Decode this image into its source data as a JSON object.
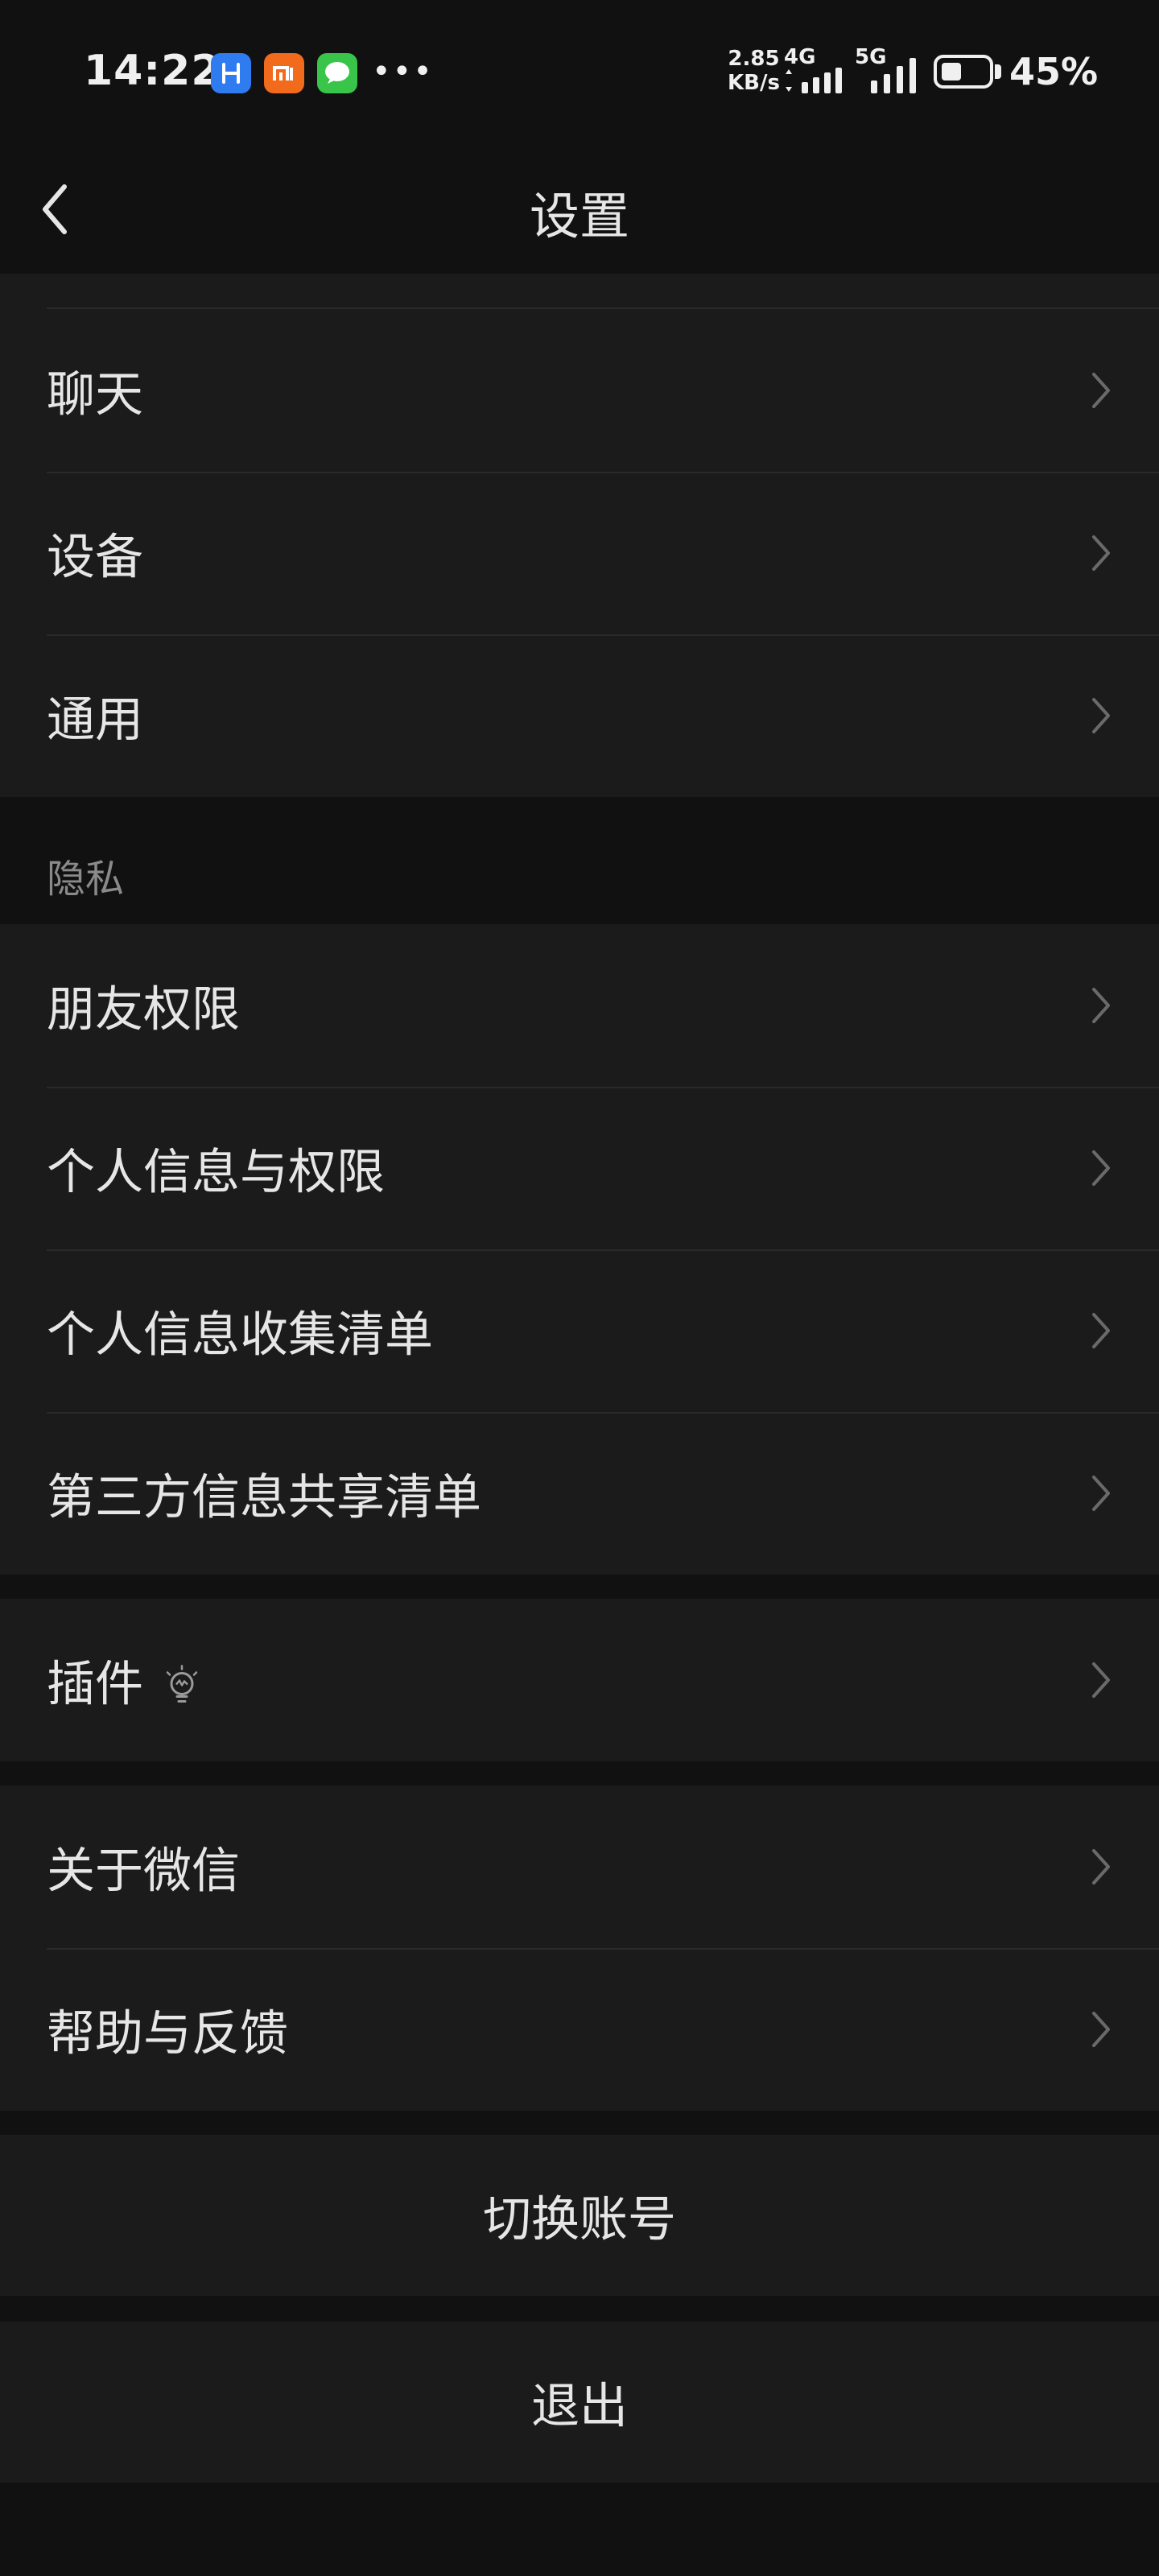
{
  "status_bar": {
    "time": "14:22",
    "net_speed_value": "2.85",
    "net_speed_unit": "KB/s",
    "signal1_label": "4G",
    "signal2_label": "5G",
    "battery_percent": "45%",
    "battery_level": 0.45,
    "app_icons": [
      "blue-app-icon",
      "mi-icon",
      "wechat-icon",
      "more-icon"
    ]
  },
  "header": {
    "title": "设置",
    "back_icon": "chevron-left-icon"
  },
  "groups": [
    {
      "items": [
        {
          "label": "聊天"
        },
        {
          "label": "设备"
        },
        {
          "label": "通用"
        }
      ]
    },
    {
      "section_title": "隐私",
      "items": [
        {
          "label": "朋友权限"
        },
        {
          "label": "个人信息与权限"
        },
        {
          "label": "个人信息收集清单"
        },
        {
          "label": "第三方信息共享清单"
        }
      ]
    },
    {
      "items": [
        {
          "label": "插件",
          "icon": "lightbulb-icon"
        }
      ]
    },
    {
      "items": [
        {
          "label": "关于微信"
        },
        {
          "label": "帮助与反馈"
        }
      ]
    }
  ],
  "actions": {
    "switch_account": "切换账号",
    "logout": "退出"
  },
  "colors": {
    "background": "#111111",
    "row_background": "#1b1b1b",
    "text": "#e6e6e6",
    "secondary_text": "#8a8a8a",
    "chevron": "#6a6a6a"
  }
}
